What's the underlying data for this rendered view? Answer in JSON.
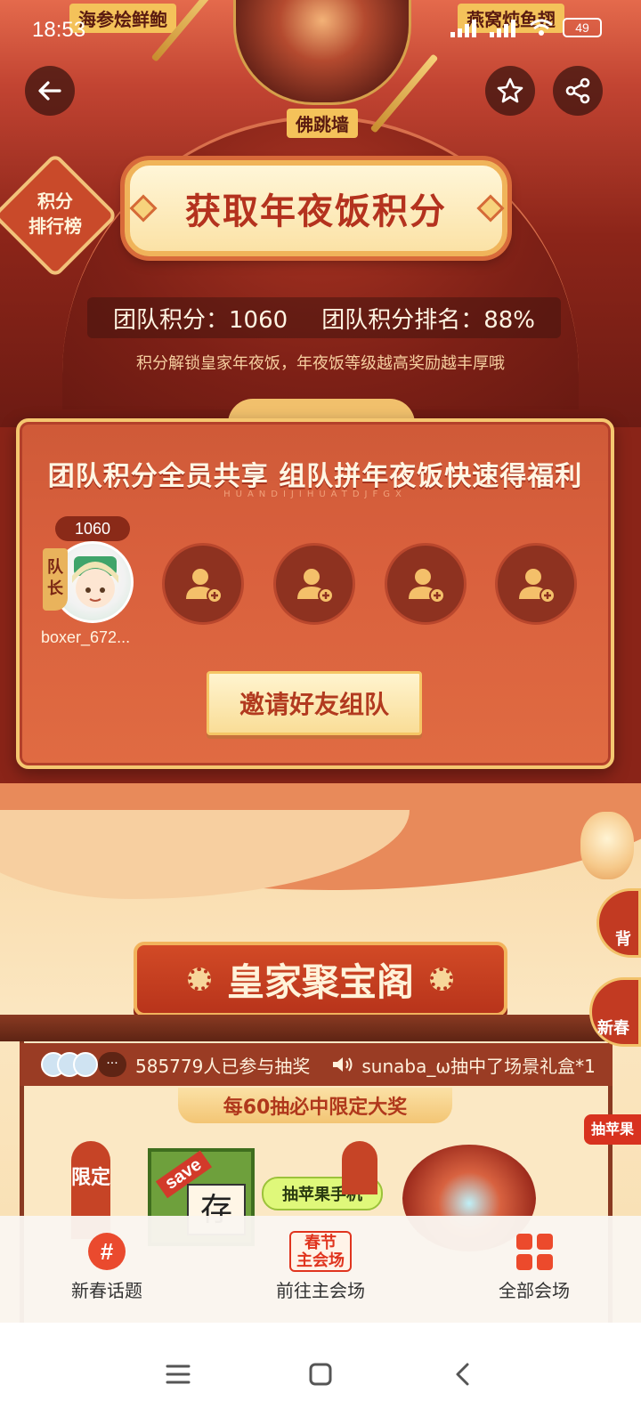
{
  "status": {
    "time": "18:53",
    "battery": "49"
  },
  "header": {
    "dishes": [
      "海参烩鲜鲍",
      "燕窝炖鱼翅",
      "佛跳墙"
    ]
  },
  "rank_badge": {
    "line1": "积分",
    "line2": "排行榜"
  },
  "title": "获取年夜饭积分",
  "team_score_label": "团队积分：1060",
  "team_rank_label": "团队积分排名：88%",
  "subtitle": "积分解锁皇家年夜饭，年夜饭等级越高奖励越丰厚哦",
  "team_panel": {
    "title": "团队积分全员共享 组队拼年夜饭快速得福利",
    "pinyin": "HUANDIJIHUATDJFGX",
    "leader": {
      "score": "1060",
      "tag": "队长",
      "name": "boxer_672..."
    },
    "invite_label": "邀请好友组队"
  },
  "treasure": {
    "title": "皇家聚宝阁",
    "participants": "585779人已参与抽奖",
    "ticker_more": "···",
    "broadcast": "sunaba_ω抽中了场景礼盒*1",
    "guarantee": "每60抽必中限定大奖",
    "limited_tag": "限定",
    "prize_save": "save",
    "prize_store": "存",
    "apple_bubble": "抽苹果手机"
  },
  "side": {
    "item1": "背",
    "item2": "新春",
    "apple": "抽苹果"
  },
  "bottom_nav": {
    "items": [
      {
        "label": "新春话题",
        "icon": "#"
      },
      {
        "label": "前往主会场",
        "icon_line1": "春节",
        "icon_line2": "主会场"
      },
      {
        "label": "全部会场"
      }
    ]
  },
  "colors": {
    "accent": "#e0341e",
    "gold": "#f5c770",
    "panel": "#d9603d"
  }
}
